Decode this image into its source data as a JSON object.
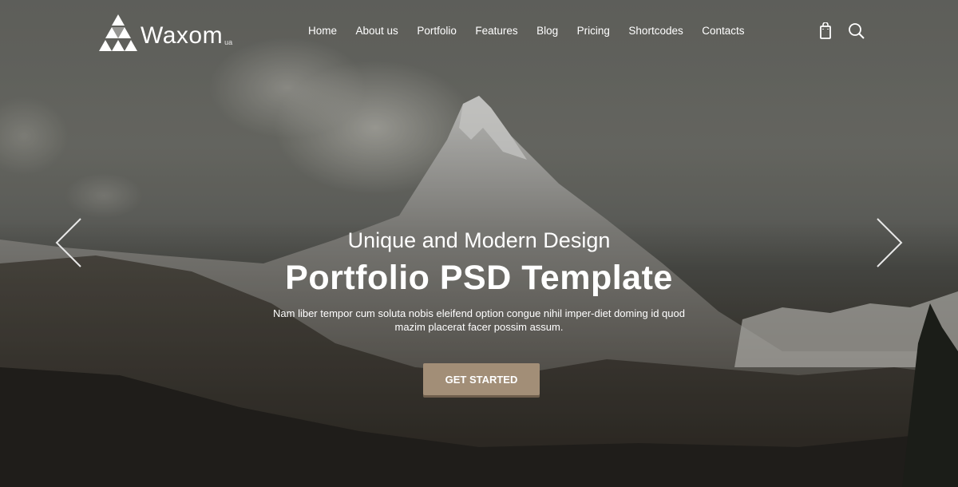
{
  "brand": {
    "name": "Waxom",
    "suffix": "ua",
    "icon": "triangle-mosaic-logo-icon"
  },
  "nav": {
    "items": [
      "Home",
      "About us",
      "Portfolio",
      "Features",
      "Blog",
      "Pricing",
      "Shortcodes",
      "Contacts"
    ],
    "icons": [
      "shopping-bag-icon",
      "search-icon"
    ]
  },
  "hero": {
    "subtitle": "Unique and Modern Design",
    "title": "Portfolio PSD Template",
    "description": "Nam liber tempor cum soluta nobis eleifend option congue nihil imper-diet doming id quod mazim placerat facer possim assum.",
    "cta_label": "GET STARTED",
    "prev_icon": "chevron-left-icon",
    "next_icon": "chevron-right-icon"
  },
  "colors": {
    "accent": "#a28e77",
    "text": "#ffffff"
  }
}
